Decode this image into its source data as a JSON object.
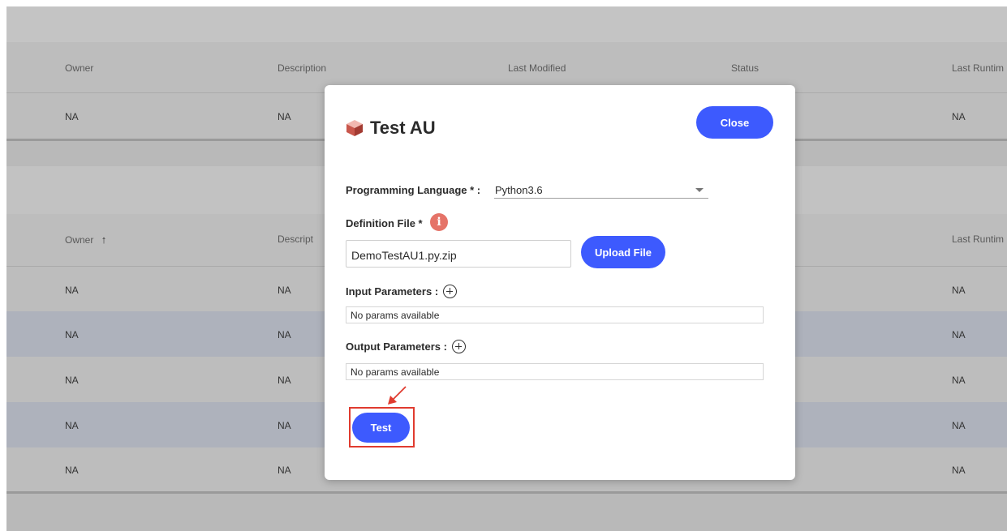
{
  "background_table": {
    "top_section": {
      "headers": [
        "Owner",
        "Description",
        "Last Modified",
        "Status",
        "Last Runtim"
      ],
      "row": [
        "NA",
        "NA",
        "NA"
      ]
    },
    "bottom_section": {
      "headers": [
        "Owner",
        "Descript",
        "Last Runtim"
      ],
      "sort_arrow": "↑",
      "rows": [
        [
          "NA",
          "NA",
          "NA"
        ],
        [
          "NA",
          "NA",
          "NA"
        ],
        [
          "NA",
          "NA",
          "NA"
        ],
        [
          "NA",
          "NA",
          "NA"
        ],
        [
          "NA",
          "NA",
          "NA"
        ]
      ]
    }
  },
  "modal": {
    "icon": "cube-icon",
    "title": "Test AU",
    "close_label": "Close",
    "programming_language_label": "Programming Language * :",
    "programming_language_value": "Python3.6",
    "definition_file_label": "Definition File *",
    "info_icon": "info-icon",
    "info_glyph": "i",
    "definition_file_value": "DemoTestAU1.py.zip",
    "upload_label": "Upload File",
    "input_params_label": "Input Parameters :",
    "input_params_value": "No params available",
    "output_params_label": "Output Parameters :",
    "output_params_value": "No params available",
    "test_label": "Test"
  },
  "colors": {
    "accent": "#3d5afe",
    "highlight": "#e03b2f",
    "info": "#e57368"
  }
}
